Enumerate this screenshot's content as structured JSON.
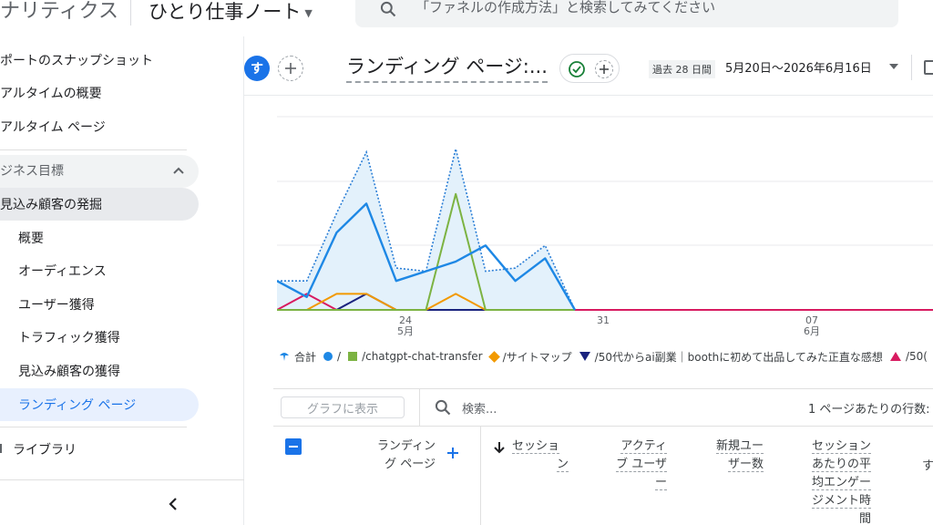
{
  "topbar": {
    "app_name": "ナリティクス",
    "account_name": "ひとり仕事ノート",
    "search_placeholder": "「ファネルの作成方法」と検索してみてください"
  },
  "sidebar": {
    "items": [
      {
        "label": "ポートのスナップショット"
      },
      {
        "label": "アルタイムの概要"
      },
      {
        "label": "アルタイム ページ"
      }
    ],
    "group_label": "ジネス目標",
    "section_label": "見込み顧客の発掘",
    "sub_items": [
      {
        "label": "概要"
      },
      {
        "label": "オーディエンス"
      },
      {
        "label": "ユーザー獲得"
      },
      {
        "label": "トラフィック獲得"
      },
      {
        "label": "見込み顧客の獲得"
      },
      {
        "label": "ランディング ページ"
      }
    ],
    "library_label": "ライブラリ"
  },
  "report": {
    "avatar_letter": "す",
    "title": "ランディング ページ:...",
    "date_prefix": "過去 28 日間",
    "date_range": "5月20日～2026年6月16日"
  },
  "chart_data": {
    "type": "line",
    "x": [
      "5/20",
      "5/21",
      "5/22",
      "5/23",
      "5/24",
      "5/25",
      "5/26",
      "5/27",
      "5/28",
      "5/29",
      "5/30",
      "5/31",
      "6/1",
      "6/2",
      "6/3",
      "6/4",
      "6/5",
      "6/6",
      "6/7",
      "6/8",
      "6/9",
      "6/10",
      "6/11"
    ],
    "x_tick_labels": [
      {
        "day": "24",
        "month": "5月"
      },
      {
        "day": "31",
        "month": ""
      },
      {
        "day": "07",
        "month": "6月"
      }
    ],
    "series": [
      {
        "name": "合計",
        "color": "#4285f4",
        "style": "dotted-area",
        "values": [
          0.9,
          0.9,
          3.0,
          4.9,
          1.3,
          1.2,
          5.0,
          1.2,
          1.3,
          2.0,
          0.0,
          0,
          0,
          0,
          0,
          0,
          0,
          0,
          0,
          0,
          0,
          0,
          0
        ]
      },
      {
        "name": "/",
        "color": "#1e88e5",
        "values": [
          0.9,
          0.4,
          2.4,
          3.3,
          0.9,
          1.2,
          1.5,
          2.0,
          0.9,
          1.6,
          0.0,
          0,
          0,
          0,
          0,
          0,
          0,
          0,
          0,
          0,
          0,
          0,
          0
        ]
      },
      {
        "name": "/chatgpt-chat-transfer",
        "color": "#7cb342",
        "values": [
          0,
          0,
          0,
          0,
          0,
          0,
          3.6,
          0,
          0,
          0,
          0,
          0,
          0,
          0,
          0,
          0,
          0,
          0,
          0,
          0,
          0,
          0,
          0
        ]
      },
      {
        "name": "/サイトマップ",
        "color": "#f29900",
        "values": [
          0,
          0,
          0.5,
          0.5,
          0,
          0,
          0.5,
          0,
          0,
          0,
          0,
          0,
          0,
          0,
          0,
          0,
          0,
          0,
          0,
          0,
          0,
          0,
          0
        ]
      },
      {
        "name": "/50代からai副業｜boothに初めて出品してみた正直な感想",
        "color": "#1a237e",
        "values": [
          0,
          0,
          0,
          0.5,
          0,
          0,
          0,
          0,
          0,
          0,
          0,
          0,
          0,
          0,
          0,
          0,
          0,
          0,
          0,
          0,
          0,
          0,
          0
        ]
      },
      {
        "name": "/50(",
        "color": "#d81b60",
        "values": [
          0,
          0.5,
          0,
          0,
          0,
          0,
          0,
          0,
          0,
          0,
          0,
          0,
          0,
          0,
          0,
          0,
          0,
          0,
          0,
          0,
          0,
          0,
          0
        ]
      }
    ],
    "ylim": [
      0,
      6
    ],
    "grid": true
  },
  "table": {
    "graph_button": "グラフに表示",
    "search_placeholder": "検索...",
    "rows_per_page_label": "1 ページあたりの行数:",
    "columns": {
      "dimension": [
        "ランディン",
        "グ ページ"
      ],
      "sessions": [
        "セッショ",
        "ン"
      ],
      "active_users": [
        "アクティ",
        "ブ ユーザ",
        "ー"
      ],
      "new_users": [
        "新規ユー",
        "ザー数"
      ],
      "avg_engagement": [
        "セッション",
        "あたりの平",
        "均エンゲー",
        "ジメント時",
        "間"
      ],
      "cut": "す"
    }
  }
}
